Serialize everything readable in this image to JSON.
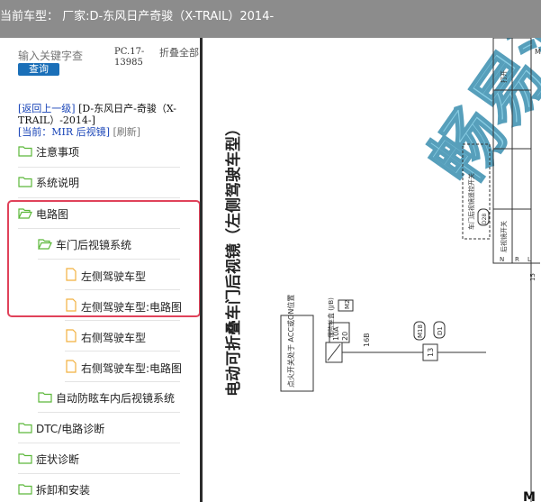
{
  "header": {
    "title": "当前车型：  厂家:D-东风日产奇骏（X-TRAIL）2014-"
  },
  "search": {
    "placeholder": "输入关键字查",
    "button": "查询"
  },
  "pc_code": "PC.17-13985",
  "fold_all": "折叠全部",
  "nav": {
    "back": "[返回上一级]",
    "vehicle": "[D-东风日产-奇骏（X-TRAIL）-2014-]",
    "current_label": "[当前：",
    "current_value": "MIR 后视镜",
    "current_close": "]",
    "refresh": "[刷新]"
  },
  "tree": [
    {
      "label": "注意事项",
      "type": "folder"
    },
    {
      "label": "系统说明",
      "type": "folder"
    },
    {
      "label": "电路图",
      "type": "folder-open"
    },
    {
      "label": "车门后视镜系统",
      "type": "folder-open"
    },
    {
      "label": "左侧驾驶车型",
      "type": "doc"
    },
    {
      "label": "左侧驾驶车型:电路图",
      "type": "doc"
    },
    {
      "label": "右侧驾驶车型",
      "type": "doc"
    },
    {
      "label": "右侧驾驶车型:电路图",
      "type": "doc"
    },
    {
      "label": "自动防眩车内后视镜系统",
      "type": "folder"
    },
    {
      "label": "DTC/电路诊断",
      "type": "folder"
    },
    {
      "label": "症状诊断",
      "type": "folder"
    },
    {
      "label": "拆卸和安装",
      "type": "folder"
    }
  ],
  "diagram": {
    "title": "电动可折叠车门后视镜（左侧驾驶车型）",
    "watermark": "畅易汽",
    "ign_label": "点火开关处于 ACC或ON位置",
    "fuse_label": "保险丝盒 (J/B)",
    "fuse_connector": "M2",
    "fuse_amp": "10A",
    "fuse_num": "20",
    "wire_16b": "16B",
    "conn_m18": "M18",
    "conn_d1": "D1",
    "pin_13": "13",
    "remote_switch": "车门后视镜遥控开关",
    "conn_d28": "D28",
    "mirror_switch": "后视镜开关",
    "col_open": "打开",
    "col_n": "N",
    "col_r": "R",
    "col_l": "L",
    "num_15": "15",
    "letter_m": "M",
    "bottom_m": "M"
  },
  "colors": {
    "topbar": "#8c8c8c",
    "search_btn": "#1a6fb8",
    "highlight": "#e0425a",
    "folder": "#5cb83a",
    "doc": "#f2b13f",
    "watermark": "#76c6e0"
  }
}
